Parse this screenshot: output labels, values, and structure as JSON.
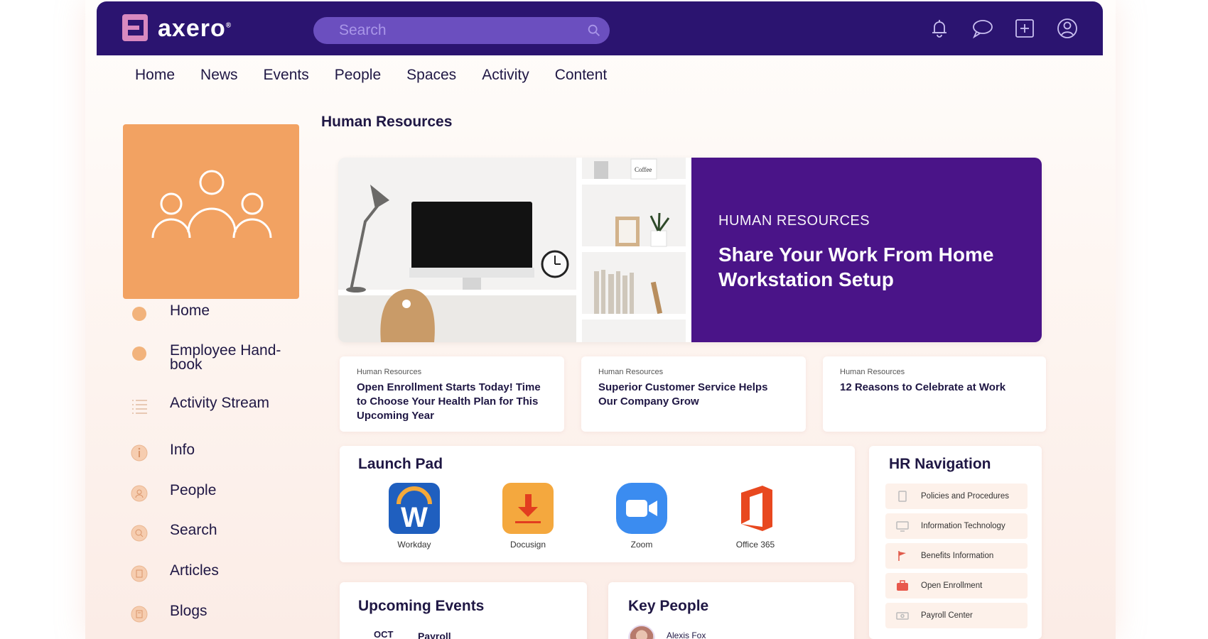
{
  "app": {
    "logo_text": "axero",
    "logo_tm": "®"
  },
  "search": {
    "placeholder": "Search"
  },
  "top_icons": [
    "bell-icon",
    "chat-icon",
    "plus-square-icon",
    "user-circle-icon"
  ],
  "nav": [
    "Home",
    "News",
    "Events",
    "People",
    "Spaces",
    "Activity",
    "Content"
  ],
  "space": {
    "title": "Human Resources",
    "tile_color": "#f2a262"
  },
  "sidebar": {
    "items": [
      {
        "label": "Home",
        "icon": "dot-icon"
      },
      {
        "label": "Employee Hand-\nbook",
        "icon": "dot-icon"
      },
      {
        "label": "Activity Stream",
        "icon": "list-icon"
      },
      {
        "label": "Info",
        "icon": "info-icon"
      },
      {
        "label": "People",
        "icon": "people-icon"
      },
      {
        "label": "Search",
        "icon": "search-icon"
      },
      {
        "label": "Articles",
        "icon": "article-icon"
      },
      {
        "label": "Blogs",
        "icon": "blog-icon"
      }
    ]
  },
  "hero": {
    "kicker": "HUMAN RESOURCES",
    "headline": "Share Your Work From Home Workstation Setup",
    "mug_text": "Coffee",
    "color": "#4a1488"
  },
  "cards": [
    {
      "category": "Human Resources",
      "title": "Open Enrollment Starts Today! Time to Choose Your Health Plan for This Upcoming Year"
    },
    {
      "category": "Human Resources",
      "title": "Superior Customer Service Helps Our Company Grow"
    },
    {
      "category": "Human Resources",
      "title": "12 Reasons to Celebrate at Work"
    }
  ],
  "launchpad": {
    "title": "Launch Pad",
    "apps": [
      {
        "label": "Workday",
        "icon": "workday-icon"
      },
      {
        "label": "Docusign",
        "icon": "docusign-icon"
      },
      {
        "label": "Zoom",
        "icon": "zoom-icon"
      },
      {
        "label": "Office 365",
        "icon": "office365-icon"
      }
    ]
  },
  "hrnav": {
    "title": "HR Navigation",
    "items": [
      {
        "label": "Policies and Procedures",
        "icon": "document-icon"
      },
      {
        "label": "Information Technology",
        "icon": "monitor-icon"
      },
      {
        "label": "Benefits Information",
        "icon": "flag-icon"
      },
      {
        "label": "Open Enrollment",
        "icon": "briefcase-icon"
      },
      {
        "label": "Payroll Center",
        "icon": "money-icon"
      }
    ]
  },
  "events": {
    "title": "Upcoming Events",
    "month": "OCT",
    "first_title": "Payroll"
  },
  "keypeople": {
    "title": "Key People",
    "first_name": "Alexis Fox"
  },
  "colors": {
    "brand": "#2b1470",
    "accent": "#f2a262",
    "hero": "#4a1488"
  }
}
